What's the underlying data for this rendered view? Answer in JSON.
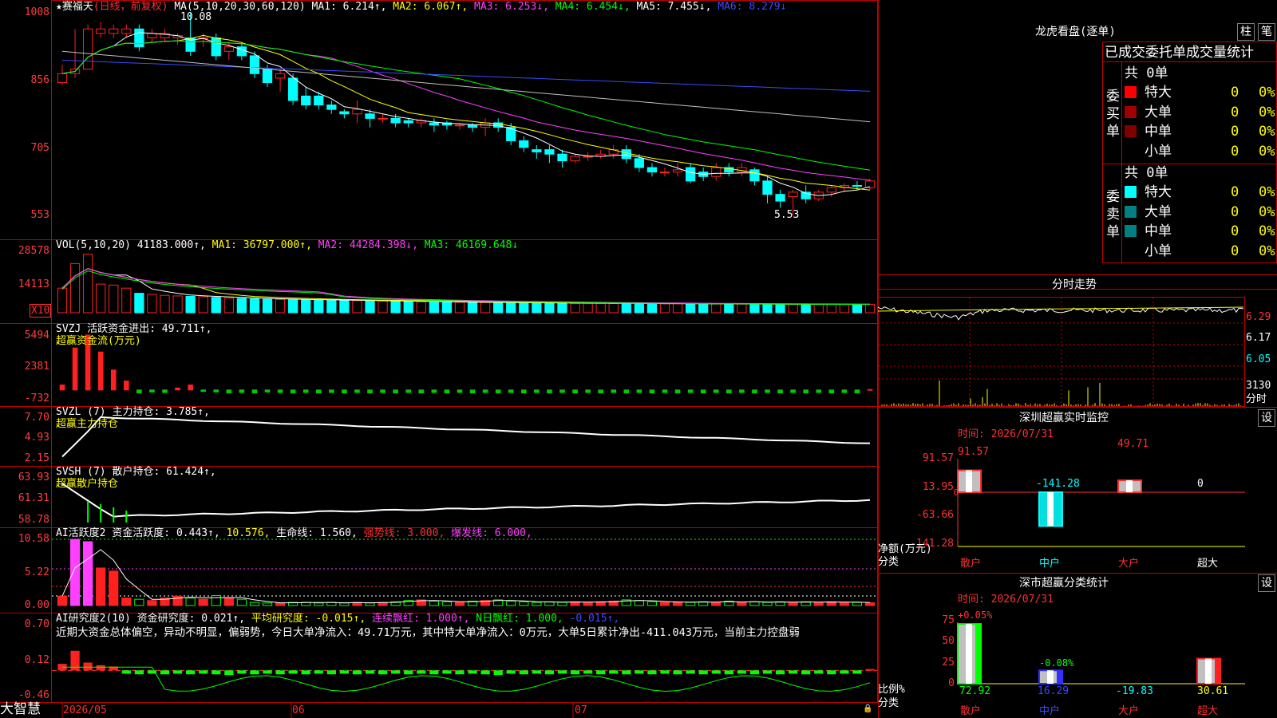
{
  "colors": {
    "up": "#ff2020",
    "down": "#00ffff",
    "frame": "#c00000",
    "bg": "#000000",
    "ma1": "#ffffff",
    "ma2": "#ffff00",
    "ma3": "#ff40ff",
    "ma4": "#00ff00",
    "ma6": "#3a4bff"
  },
  "header": {
    "title": "★赛福天",
    "mode": "(日线，前复权)",
    "ma_label": "MA(5,10,20,30,60,120)",
    "ma1": "MA1: 6.214↑,",
    "ma2": "MA2: 6.067↑,",
    "ma3": "MA3: 6.253↓,",
    "ma4": "MA4: 6.454↓,",
    "ma5": "MA5: 7.455↓,",
    "ma6": "MA6: 8.279↓",
    "high_mark": "10.08",
    "low_mark": "5.53"
  },
  "price_axis": [
    "1008",
    "856",
    "705",
    "553"
  ],
  "vol": {
    "label": "VOL(5,10,20)",
    "value": "41183.000↑,",
    "ma1": "MA1: 36797.000↑,",
    "ma2": "MA2: 44284.398↓,",
    "ma3": "MA3: 46169.648↓",
    "axis": [
      "28578",
      "14113"
    ],
    "unit": "X10"
  },
  "svzj": {
    "label": "SVZJ 活跃资金进出: 49.711↑,",
    "sub": "超赢资金流(万元)",
    "axis": [
      "5494",
      "2381",
      "-732"
    ]
  },
  "svzl": {
    "label": "SVZL (7) 主力持仓: 3.785↑,",
    "sub": "超赢主力持仓",
    "axis": [
      "7.70",
      "4.93",
      "2.15"
    ]
  },
  "svsh": {
    "label": "SVSH (7) 散户持仓: 61.424↑,",
    "sub": "超赢散户持仓",
    "axis": [
      "63.93",
      "61.31",
      "58.78"
    ]
  },
  "ai_act": {
    "p1": "AI活跃度2 资金活跃度: 0.443↑,",
    "p2": "10.576,",
    "p3": "生命线: 1.560,",
    "p4": "强势线: 3.000,",
    "p5": "爆发线: 6.000,",
    "axis": [
      "10.58",
      "5.22",
      "0.00"
    ]
  },
  "ai_res": {
    "p1": "AI研究度2(10) 资金研究度: 0.021↑,",
    "p2": "平均研究度: -0.015↑,",
    "p3": "连续飘红: 1.000↑,",
    "p4": "N日飘红: 1.000,",
    "p5": "-0.015↑,",
    "comment": "近期大资金总体偏空，异动不明显，偏弱势，今日大单净流入：49.71万元，其中特大单净流入：0万元，大单5日累计净出-411.043万元，当前主力控盘弱",
    "axis": [
      "0.70",
      "0.12",
      "-0.46"
    ]
  },
  "bottom": {
    "brand": "大智慧",
    "dates": [
      "2026/05",
      "06",
      "07"
    ]
  },
  "lhb": {
    "title": "龙虎看盘(逐单)",
    "btn1": "柱",
    "btn2": "笔",
    "heading": "已成交委托单成交量统计",
    "buy_label": "委买单",
    "sell_label": "委卖单",
    "buy_total": "共 0单",
    "sell_total": "共 0单",
    "buy_rows": [
      {
        "name": "特大",
        "count": "0",
        "pct": "0%",
        "color": "#ff0000"
      },
      {
        "name": "大单",
        "count": "0",
        "pct": "0%",
        "color": "#a00000"
      },
      {
        "name": "中单",
        "count": "0",
        "pct": "0%",
        "color": "#800000"
      },
      {
        "name": "小单",
        "count": "0",
        "pct": "0%",
        "color": ""
      }
    ],
    "sell_rows": [
      {
        "name": "特大",
        "count": "0",
        "pct": "0%",
        "color": "#00ffff"
      },
      {
        "name": "大单",
        "count": "0",
        "pct": "0%",
        "color": "#008080"
      },
      {
        "name": "中单",
        "count": "0",
        "pct": "0%",
        "color": "#008080"
      },
      {
        "name": "小单",
        "count": "0",
        "pct": "0%",
        "color": ""
      }
    ]
  },
  "intraday": {
    "title": "分时走势",
    "axis": [
      "6.29",
      "6.17",
      "6.05"
    ],
    "vol_axis": "3130",
    "vol_unit": "分时"
  },
  "sz_monitor": {
    "title": "深圳超赢实时监控",
    "btn": "设",
    "time": "时间: 2026/07/31",
    "axis": [
      "91.57",
      "13.95",
      "0",
      "-63.66",
      "-141.28"
    ],
    "ylabel": "净额(万元)",
    "xlabel": "分类",
    "cats": [
      "散户",
      "中户",
      "大户",
      "超大"
    ],
    "values": [
      "91.57",
      "-141.28",
      "49.71",
      "0"
    ]
  },
  "sz_class": {
    "title": "深市超赢分类统计",
    "btn": "设",
    "time": "时间: 2026/07/31",
    "axis": [
      "75",
      "50",
      "25",
      "0"
    ],
    "ylabel": "比例%",
    "xlabel": "分类",
    "top_pct": "+0.05%",
    "mid_pct": "-0.08%",
    "cats": [
      "散户",
      "中户",
      "大户",
      "超大"
    ],
    "values": [
      "72.92",
      "16.29",
      "-19.83",
      "30.61"
    ]
  },
  "chart_data": [
    {
      "type": "candlestick",
      "title": "★赛福天",
      "ylim": [
        5.53,
        10.08
      ],
      "price_ticks": [
        "10.08",
        "8.56",
        "7.05",
        "5.53"
      ],
      "candles": [
        [
          8.5,
          8.7,
          8.45,
          8.9
        ],
        [
          8.7,
          8.8,
          8.6,
          9.7
        ],
        [
          8.8,
          9.7,
          8.8,
          9.8
        ],
        [
          9.6,
          9.7,
          9.5,
          9.85
        ],
        [
          9.6,
          9.7,
          9.5,
          9.8
        ],
        [
          9.6,
          9.7,
          9.5,
          9.8
        ],
        [
          9.7,
          9.3,
          9.2,
          9.8
        ],
        [
          9.5,
          9.6,
          9.4,
          9.7
        ],
        [
          9.5,
          9.6,
          9.4,
          9.7
        ],
        [
          9.5,
          9.55,
          9.35,
          9.6
        ],
        [
          9.5,
          9.2,
          9.1,
          10.08
        ],
        [
          9.5,
          9.5,
          9.3,
          9.6
        ],
        [
          9.5,
          9.1,
          9.0,
          9.6
        ],
        [
          9.2,
          9.3,
          9.0,
          9.4
        ],
        [
          9.3,
          9.1,
          9.0,
          9.4
        ],
        [
          9.1,
          8.7,
          8.6,
          9.2
        ],
        [
          8.8,
          8.5,
          8.4,
          8.9
        ],
        [
          8.6,
          8.7,
          8.3,
          8.8
        ],
        [
          8.6,
          8.1,
          8.0,
          8.7
        ],
        [
          8.2,
          8.0,
          7.9,
          8.4
        ],
        [
          8.2,
          8.0,
          7.9,
          8.3
        ],
        [
          8.0,
          7.9,
          7.8,
          8.1
        ],
        [
          7.85,
          7.8,
          7.7,
          7.9
        ],
        [
          7.8,
          7.9,
          7.6,
          8.1
        ],
        [
          7.8,
          7.7,
          7.5,
          7.9
        ],
        [
          7.7,
          7.7,
          7.6,
          7.8
        ],
        [
          7.7,
          7.6,
          7.5,
          7.8
        ],
        [
          7.65,
          7.6,
          7.5,
          7.7
        ],
        [
          7.6,
          7.65,
          7.5,
          7.7
        ],
        [
          7.6,
          7.55,
          7.4,
          7.7
        ],
        [
          7.6,
          7.55,
          7.45,
          7.65
        ],
        [
          7.55,
          7.55,
          7.45,
          7.6
        ],
        [
          7.55,
          7.5,
          7.4,
          7.6
        ],
        [
          7.5,
          7.6,
          7.3,
          7.7
        ],
        [
          7.6,
          7.5,
          7.4,
          7.7
        ],
        [
          7.5,
          7.2,
          7.1,
          7.6
        ],
        [
          7.2,
          7.05,
          6.95,
          7.3
        ],
        [
          7.0,
          6.95,
          6.8,
          7.1
        ],
        [
          7.0,
          6.9,
          6.7,
          7.1
        ],
        [
          6.9,
          6.75,
          6.6,
          7.0
        ],
        [
          6.75,
          6.85,
          6.7,
          6.9
        ],
        [
          6.85,
          6.85,
          6.75,
          6.95
        ],
        [
          6.85,
          6.9,
          6.8,
          7.0
        ],
        [
          6.9,
          7.0,
          6.8,
          7.1
        ],
        [
          7.0,
          6.8,
          6.7,
          7.1
        ],
        [
          6.8,
          6.6,
          6.5,
          6.9
        ],
        [
          6.6,
          6.5,
          6.4,
          6.7
        ],
        [
          6.5,
          6.5,
          6.4,
          6.6
        ],
        [
          6.5,
          6.55,
          6.4,
          6.7
        ],
        [
          6.6,
          6.3,
          6.25,
          6.7
        ],
        [
          6.5,
          6.4,
          6.3,
          6.6
        ],
        [
          6.4,
          6.6,
          6.3,
          6.7
        ],
        [
          6.6,
          6.5,
          6.4,
          6.7
        ],
        [
          6.5,
          6.6,
          6.4,
          6.7
        ],
        [
          6.55,
          6.3,
          6.2,
          6.6
        ],
        [
          6.3,
          6.0,
          5.8,
          6.4
        ],
        [
          6.0,
          5.85,
          5.7,
          6.1
        ],
        [
          5.95,
          6.05,
          5.53,
          6.1
        ],
        [
          6.05,
          5.9,
          5.8,
          6.2
        ],
        [
          5.9,
          6.05,
          5.85,
          6.1
        ],
        [
          6.05,
          6.15,
          5.95,
          6.2
        ],
        [
          6.15,
          6.2,
          6.05,
          6.25
        ],
        [
          6.2,
          6.18,
          6.1,
          6.3
        ],
        [
          6.15,
          6.3,
          6.1,
          6.35
        ]
      ]
    },
    {
      "type": "bar",
      "title": "VOL(5,10,20)",
      "values": [
        12000,
        24000,
        28578,
        14000,
        13500,
        12000,
        9500,
        9000,
        8500,
        8200,
        8000,
        7800,
        7500,
        7200,
        7000,
        6800,
        6600,
        6500,
        6400,
        6300,
        6200,
        6100,
        6000,
        5900,
        5800,
        5700,
        5600,
        5500,
        5400,
        5300,
        5200,
        5100,
        5000,
        5000,
        4900,
        4900,
        4800,
        4800,
        4700,
        4700,
        4600,
        4600,
        4600,
        4500,
        4500,
        4500,
        4400,
        4400,
        4400,
        4300,
        4300,
        4300,
        4300,
        4200,
        4200,
        4200,
        4200,
        4100,
        4100,
        4100,
        4100,
        4100,
        4118,
        4118
      ]
    },
    {
      "type": "bar",
      "title": "超赢资金流(万元)",
      "values": [
        500,
        4200,
        5494,
        3800,
        2000,
        900,
        -300,
        -200,
        -250,
        200,
        500,
        -150,
        -200,
        -300,
        -250,
        -300,
        -200,
        -250,
        -300,
        -250,
        -300,
        -250,
        -300,
        -250,
        -300,
        -250,
        -300,
        -250,
        -300,
        -250,
        -300,
        -250,
        -300,
        -250,
        -300,
        -250,
        -300,
        -250,
        -300,
        -250,
        -300,
        -250,
        -300,
        -250,
        -300,
        -250,
        -300,
        -250,
        -300,
        -250,
        -300,
        -250,
        -300,
        -250,
        -300,
        -250,
        -300,
        -250,
        -300,
        -250,
        -300,
        -250,
        -300,
        49.711
      ]
    },
    {
      "type": "bar",
      "title": "AI活跃度2",
      "values": [
        1.5,
        10.58,
        10.2,
        6.0,
        5.5,
        1.2,
        1.0,
        0.8,
        1.2,
        1.5,
        1.2,
        1.0,
        1.6,
        1.2,
        1.0,
        0.5,
        0.4,
        0.4,
        0.5,
        0.5,
        0.4,
        0.5,
        0.4,
        0.5,
        0.4,
        0.5,
        0.6,
        0.8,
        0.9,
        0.7,
        0.6,
        0.5,
        0.7,
        0.8,
        0.9,
        0.7,
        0.6,
        0.5,
        0.6,
        0.5,
        0.6,
        0.5,
        0.6,
        0.7,
        0.9,
        0.8,
        0.6,
        0.5,
        0.6,
        0.5,
        0.6,
        0.5,
        0.7,
        0.5,
        0.6,
        0.5,
        0.6,
        0.5,
        0.6,
        0.5,
        0.6,
        0.5,
        0.5,
        0.443
      ]
    },
    {
      "type": "bar",
      "title": "AI研究度2(10)",
      "values": [
        0.1,
        0.3,
        0.12,
        0.08,
        0.06,
        -0.05,
        -0.06,
        -0.05,
        -0.06,
        -0.05,
        -0.06,
        -0.05,
        -0.06,
        -0.07,
        -0.05,
        -0.06,
        -0.05,
        -0.06,
        -0.05,
        -0.06,
        -0.05,
        -0.06,
        -0.05,
        -0.06,
        -0.05,
        -0.06,
        -0.05,
        -0.06,
        -0.05,
        -0.06,
        -0.05,
        -0.06,
        -0.05,
        -0.06,
        -0.07,
        -0.05,
        -0.06,
        -0.05,
        -0.06,
        -0.05,
        -0.06,
        -0.05,
        -0.06,
        -0.05,
        -0.06,
        -0.05,
        -0.06,
        -0.05,
        -0.06,
        -0.05,
        -0.06,
        -0.05,
        -0.06,
        -0.05,
        -0.06,
        -0.05,
        -0.06,
        -0.05,
        -0.06,
        -0.05,
        -0.06,
        -0.05,
        -0.05,
        0.021
      ]
    }
  ]
}
